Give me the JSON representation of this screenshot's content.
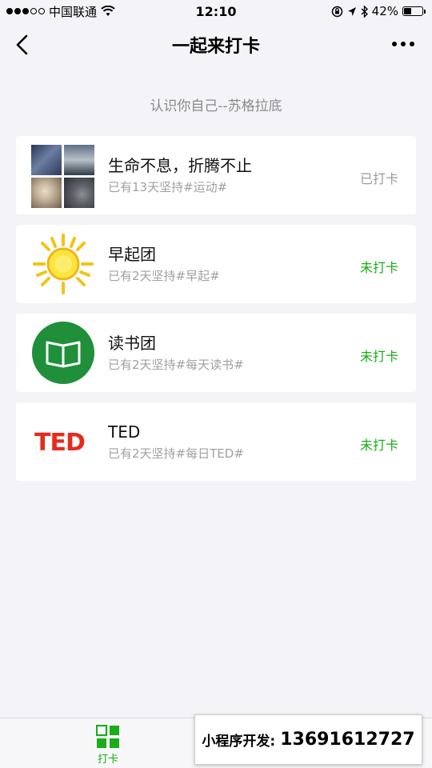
{
  "status_bar": {
    "carrier": "中国联通",
    "time": "12:10",
    "battery_text": "42%",
    "battery_level": 0.42
  },
  "nav": {
    "title": "一起来打卡"
  },
  "quote": "认识你自己--苏格拉底",
  "groups": [
    {
      "title": "生命不息，折腾不止",
      "meta": "已有13天坚持#运动#",
      "status": "已打卡",
      "checked": true
    },
    {
      "title": "早起团",
      "meta": "已有2天坚持#早起#",
      "status": "未打卡",
      "checked": false
    },
    {
      "title": "读书团",
      "meta": "已有2天坚持#每天读书#",
      "status": "未打卡",
      "checked": false
    },
    {
      "title": "TED",
      "meta": "已有2天坚持#每日TED#",
      "status": "未打卡",
      "checked": false,
      "logo_text": "TED"
    }
  ],
  "tab_bar": {
    "tabs": [
      {
        "label": "打卡",
        "icon": "grid-icon",
        "active": true
      }
    ]
  },
  "promo": {
    "label": "小程序开发:",
    "phone": "13691612727"
  },
  "colors": {
    "accent_green": "#1aad19",
    "muted_gray": "#9b9b9b",
    "ted_red": "#e62b1e",
    "background": "#f4f3f7"
  }
}
